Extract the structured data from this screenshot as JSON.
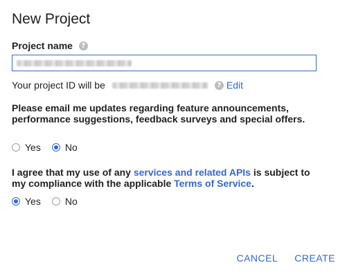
{
  "dialog": {
    "title": "New Project"
  },
  "project_name": {
    "label": "Project name",
    "help_icon": "help-circle-icon"
  },
  "project_id": {
    "prefix": "Your project ID will be",
    "help_icon": "help-circle-icon",
    "edit_label": "Edit"
  },
  "email_pref": {
    "question": "Please email me updates regarding feature announcements, performance suggestions, feedback surveys and special offers.",
    "options": [
      {
        "label": "Yes",
        "checked": false
      },
      {
        "label": "No",
        "checked": true
      }
    ]
  },
  "terms": {
    "part1": "I agree that my use of any ",
    "link1": "services and related APIs",
    "part2": " is subject to my compliance with the applicable ",
    "link2": "Terms of Service",
    "part3": ".",
    "options": [
      {
        "label": "Yes",
        "checked": true
      },
      {
        "label": "No",
        "checked": false
      }
    ]
  },
  "actions": {
    "cancel_label": "CANCEL",
    "create_label": "CREATE"
  },
  "colors": {
    "accent": "#3367d6",
    "text": "#212121",
    "icon_gray": "#bdbdbd"
  }
}
